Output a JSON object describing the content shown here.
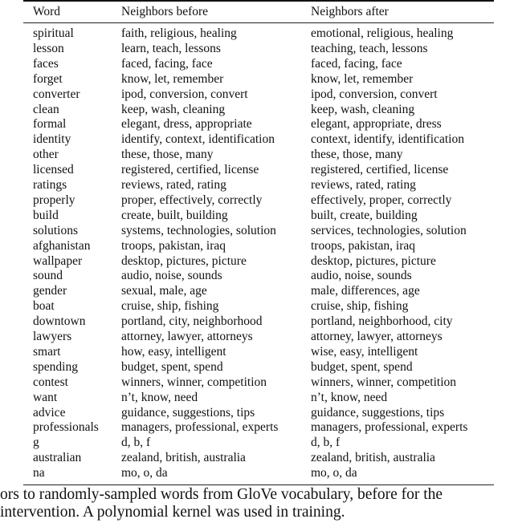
{
  "table": {
    "headers": [
      "Word",
      "Neighbors before",
      "Neighbors after"
    ],
    "rows": [
      [
        "spiritual",
        "faith, religious, healing",
        "emotional, religious, healing"
      ],
      [
        "lesson",
        "learn, teach, lessons",
        "teaching, teach, lessons"
      ],
      [
        "faces",
        "faced, facing, face",
        "faced, facing, face"
      ],
      [
        "forget",
        "know, let, remember",
        "know, let, remember"
      ],
      [
        "converter",
        "ipod, conversion, convert",
        "ipod, conversion, convert"
      ],
      [
        "clean",
        "keep, wash, cleaning",
        "keep, wash, cleaning"
      ],
      [
        "formal",
        "elegant, dress, appropriate",
        "elegant, appropriate, dress"
      ],
      [
        "identity",
        "identify, context, identification",
        "context, identify, identification"
      ],
      [
        "other",
        "these, those, many",
        "these, those, many"
      ],
      [
        "licensed",
        "registered, certified, license",
        "registered, certified, license"
      ],
      [
        "ratings",
        "reviews, rated, rating",
        "reviews, rated, rating"
      ],
      [
        "properly",
        "proper, effectively, correctly",
        "effectively, proper, correctly"
      ],
      [
        "build",
        "create, built, building",
        "built, create, building"
      ],
      [
        "solutions",
        "systems, technologies, solution",
        "services, technologies, solution"
      ],
      [
        "afghanistan",
        "troops, pakistan, iraq",
        "troops, pakistan, iraq"
      ],
      [
        "wallpaper",
        "desktop, pictures, picture",
        "desktop, pictures, picture"
      ],
      [
        "sound",
        "audio, noise, sounds",
        "audio, noise, sounds"
      ],
      [
        "gender",
        "sexual, male, age",
        "male, differences, age"
      ],
      [
        "boat",
        "cruise, ship, fishing",
        "cruise, ship, fishing"
      ],
      [
        "downtown",
        "portland, city, neighborhood",
        "portland, neighborhood, city"
      ],
      [
        "lawyers",
        "attorney, lawyer, attorneys",
        "attorney, lawyer, attorneys"
      ],
      [
        "smart",
        "how, easy, intelligent",
        "wise, easy, intelligent"
      ],
      [
        "spending",
        "budget, spent, spend",
        "budget, spent, spend"
      ],
      [
        "contest",
        "winners, winner, competition",
        "winners, winner, competition"
      ],
      [
        "want",
        "n’t, know, need",
        "n’t, know, need"
      ],
      [
        "advice",
        "guidance, suggestions, tips",
        "guidance, suggestions, tips"
      ],
      [
        "professionals",
        "managers, professional, experts",
        "managers, professional, experts"
      ],
      [
        "g",
        "d, b, f",
        "d, b, f"
      ],
      [
        "australian",
        "zealand, british, australia",
        "zealand, british, australia"
      ],
      [
        "na",
        "mo, o, da",
        "mo, o, da"
      ]
    ]
  },
  "caption": {
    "line1": "ors to randomly-sampled words from GloVe vocabulary, before for the",
    "line2": " intervention. A polynomial kernel was used in training."
  }
}
